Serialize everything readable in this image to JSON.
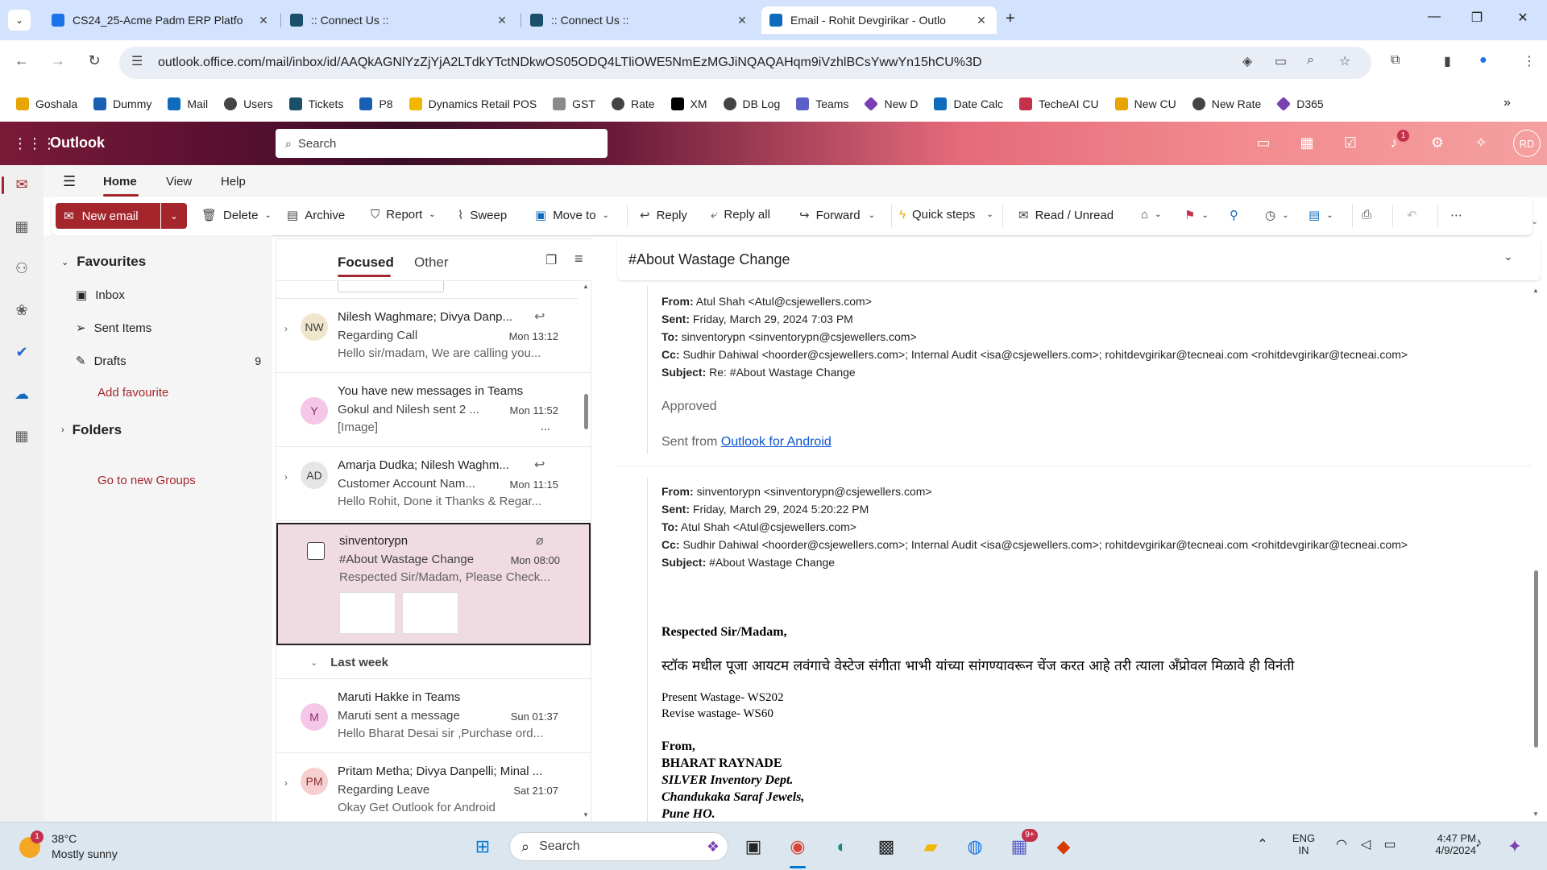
{
  "browser": {
    "tabs": [
      {
        "title": "CS24_25-Acme Padm ERP Platfo",
        "color": "#1a73e8"
      },
      {
        "title": ":: Connect Us ::",
        "color": "#1b4f6b"
      },
      {
        "title": ":: Connect Us ::",
        "color": "#1b4f6b"
      },
      {
        "title": "Email - Rohit Devgirikar - Outlo",
        "color": "#0f6cbd"
      }
    ],
    "url": "outlook.office.com/mail/inbox/id/AAQkAGNlYzZjYjA2LTdkYTctNDkwOS05ODQ4LTliOWE5NmEzMGJiNQAQAHqm9iVzhlBCsYwwYn15hCU%3D",
    "bookmarks": [
      {
        "label": "Goshala",
        "color": "#e8a400"
      },
      {
        "label": "Dummy",
        "color": "#1a5fb4"
      },
      {
        "label": "Mail",
        "color": "#0f6cbd"
      },
      {
        "label": "Users",
        "color": "#444444"
      },
      {
        "label": "Tickets",
        "color": "#1b4f6b"
      },
      {
        "label": "P8",
        "color": "#1a5fb4"
      },
      {
        "label": "Dynamics Retail POS",
        "color": "#f2b600"
      },
      {
        "label": "GST",
        "color": "#8a8a8a"
      },
      {
        "label": "Rate",
        "color": "#444444"
      },
      {
        "label": "XM",
        "color": "#000000"
      },
      {
        "label": "DB Log",
        "color": "#444444"
      },
      {
        "label": "Teams",
        "color": "#5b5fc7"
      },
      {
        "label": "New D",
        "color": "#7b3fb3"
      },
      {
        "label": "Date Calc",
        "color": "#0f6cbd"
      },
      {
        "label": "TecheAI CU",
        "color": "#c4314b"
      },
      {
        "label": "New CU",
        "color": "#e8a400"
      },
      {
        "label": "New Rate",
        "color": "#444444"
      },
      {
        "label": "D365",
        "color": "#7b3fb3"
      }
    ]
  },
  "outlook": {
    "app_name": "Outlook",
    "search_placeholder": "Search",
    "notification_count": "1",
    "avatar_initials": "RD",
    "ribbon_tabs": [
      "Home",
      "View",
      "Help"
    ],
    "ribbon": {
      "new_email": "New email",
      "delete": "Delete",
      "archive": "Archive",
      "report": "Report",
      "sweep": "Sweep",
      "move_to": "Move to",
      "reply": "Reply",
      "reply_all": "Reply all",
      "forward": "Forward",
      "quick_steps": "Quick steps",
      "read_unread": "Read / Unread"
    },
    "folders": {
      "favourites": "Favourites",
      "inbox": "Inbox",
      "sent": "Sent Items",
      "drafts": "Drafts",
      "drafts_count": "9",
      "add_favourite": "Add favourite",
      "folders": "Folders",
      "new_groups": "Go to new Groups"
    },
    "list_tabs": {
      "focused": "Focused",
      "other": "Other"
    },
    "group_last_week": "Last week",
    "messages": [
      {
        "initials": "NW",
        "avatar_color": "#f0e6cc",
        "from": "Nilesh Waghmare; Divya Danp...",
        "subject": "Regarding Call",
        "time": "Mon 13:12",
        "preview": "Hello sir/madam, We are calling you..."
      },
      {
        "initials": "Y",
        "avatar_color": "#f4c6e8",
        "from": "You have new messages in Teams",
        "subject": "Gokul and Nilesh sent 2 ...",
        "time": "Mon 11:52",
        "preview": "[Image]",
        "more": "..."
      },
      {
        "initials": "AD",
        "avatar_color": "#e6e6e6",
        "from": "Amarja Dudka; Nilesh Waghm...",
        "subject": "Customer Account Nam...",
        "time": "Mon 11:15",
        "preview": "Hello Rohit, Done it Thanks & Regar..."
      },
      {
        "from": "sinventorypn",
        "subject": "#About Wastage Change",
        "time": "Mon 08:00",
        "preview": "Respected Sir/Madam, Please Check..."
      },
      {
        "initials": "M",
        "avatar_color": "#f4c6e8",
        "from": "Maruti Hakke in Teams",
        "subject": "Maruti sent a message",
        "time": "Sun 01:37",
        "preview": "Hello Bharat Desai sir ,Purchase ord..."
      },
      {
        "initials": "PM",
        "avatar_color": "#f6d0d0",
        "from": "Pritam Metha; Divya Danpelli; Minal ...",
        "subject": "Regarding Leave",
        "time": "Sat 21:07",
        "preview": "Okay Get Outlook for Android"
      }
    ],
    "reading": {
      "subject": "#About Wastage Change",
      "msg1": {
        "from_label": "From:",
        "from": "Atul Shah <Atul@csjewellers.com>",
        "sent_label": "Sent:",
        "sent": "Friday, March 29, 2024 7:03 PM",
        "to_label": "To:",
        "to": "sinventorypn <sinventorypn@csjewellers.com>",
        "cc_label": "Cc:",
        "cc": "Sudhir Dahiwal <hoorder@csjewellers.com>; Internal Audit <isa@csjewellers.com>; rohitdevgirikar@tecneai.com <rohitdevgirikar@tecneai.com>",
        "subject_label": "Subject:",
        "subject": "Re: #About Wastage Change",
        "body": "Approved",
        "sent_from": "Sent from ",
        "link": "Outlook for Android"
      },
      "msg2": {
        "from_label": "From:",
        "from": "sinventorypn <sinventorypn@csjewellers.com>",
        "sent_label": "Sent:",
        "sent": "Friday, March 29, 2024 5:20:22 PM",
        "to_label": "To:",
        "to": "Atul Shah <Atul@csjewellers.com>",
        "cc_label": "Cc:",
        "cc": "Sudhir Dahiwal <hoorder@csjewellers.com>; Internal Audit <isa@csjewellers.com>; rohitdevgirikar@tecneai.com <rohitdevgirikar@tecneai.com>",
        "subject_label": "Subject:",
        "subject": "#About Wastage Change",
        "greeting": "Respected Sir/Madam,",
        "marathi": "स्टॉक मधील पूजा आयटम लवंगाचे वेस्टेज संगीता भाभी  यांच्या  सांगण्यावरून चेंज करत आहे तरी त्याला अँप्रोवल मिळावे ही विनंती",
        "present": "Present Wastage-  WS202",
        "revise": "Revise wastage-  WS60",
        "from_sig": "From,",
        "sig_name": "BHARAT RAYNADE",
        "sig_dept": "SILVER Inventory Dept.",
        "sig_company": "Chandukaka Saraf Jewels,",
        "sig_city": "Pune HO."
      }
    }
  },
  "taskbar": {
    "weather_temp": "38°C",
    "weather_desc": "Mostly sunny",
    "weather_badge": "1",
    "search": "Search",
    "lang1": "ENG",
    "lang2": "IN",
    "time": "4:47 PM",
    "date": "4/9/2024",
    "teams_badge": "9+"
  }
}
